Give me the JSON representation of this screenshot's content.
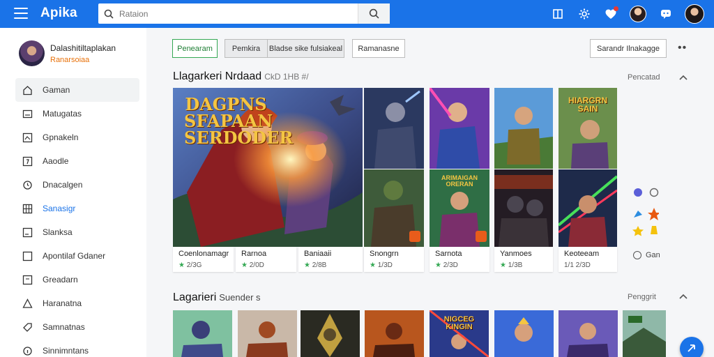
{
  "app": {
    "title": "Apika",
    "search_placeholder": "Rataion"
  },
  "topbar": {
    "icons": [
      "menu-icon",
      "search-icon",
      "panel-icon",
      "settings-icon",
      "notification-icon",
      "avatar",
      "chat-icon",
      "profile-avatar"
    ]
  },
  "profile": {
    "name": "Dalashitiltaplakan",
    "subtitle": "Ranarsoiaa"
  },
  "sidebar": {
    "items": [
      {
        "label": "Gaman",
        "icon": "home-icon",
        "active": true
      },
      {
        "label": "Matugatas",
        "icon": "mail-icon"
      },
      {
        "label": "Gpnakeln",
        "icon": "image-icon"
      },
      {
        "label": "Aaodle",
        "icon": "sparkle-icon"
      },
      {
        "label": "Dnacalgen",
        "icon": "clock-icon"
      },
      {
        "label": "Sanasigr",
        "icon": "grid-icon",
        "highlight": true
      },
      {
        "label": "Slanksa",
        "icon": "window-icon"
      },
      {
        "label": "Apontilaf Gdaner",
        "icon": "square-icon"
      },
      {
        "label": "Greadarn",
        "icon": "document-icon"
      },
      {
        "label": "Haranatna",
        "icon": "warning-icon"
      },
      {
        "label": "Samnatnas",
        "icon": "tag-icon"
      },
      {
        "label": "Sinnimntans",
        "icon": "info-icon"
      }
    ]
  },
  "filters": {
    "primary": "Penearam",
    "tab1": "Pemkira",
    "tab2": "Bladse sike fulsiakeal",
    "tab3": "Ramanasne",
    "sort": "Sarandr Ilnakagge"
  },
  "section1": {
    "title": "Llagarkeri Nrdaad",
    "subtitle": "CkD 1HB #/",
    "link": "Pencatad",
    "feature_art": "DAGPNS SFAPAAN SERDODER",
    "cards": [
      {
        "title": "Coenlonamagr",
        "rating": "2/3G"
      },
      {
        "title": "Rarnoa",
        "rating": "2/0D"
      },
      {
        "title": "Baniaaii",
        "rating": "2/8B"
      },
      {
        "title": "Snongrn",
        "rating": "1/3D"
      },
      {
        "title": "Sarnota",
        "rating": "2/3D"
      },
      {
        "title": "Yanmoes",
        "rating": "1/3B"
      },
      {
        "title": "Keoteeam",
        "rating": "1/1 2/3D"
      }
    ],
    "card_arts": {
      "c5_top": "HIARGRN SAIN",
      "c3_bottom": "ARIMAIGAN ORERAN"
    },
    "side_label": "Gan"
  },
  "section2": {
    "title": "Lagarieri",
    "subtitle": "Suender s",
    "link": "Penggrit",
    "thumb_art": "NIGCEG KINGIN"
  }
}
